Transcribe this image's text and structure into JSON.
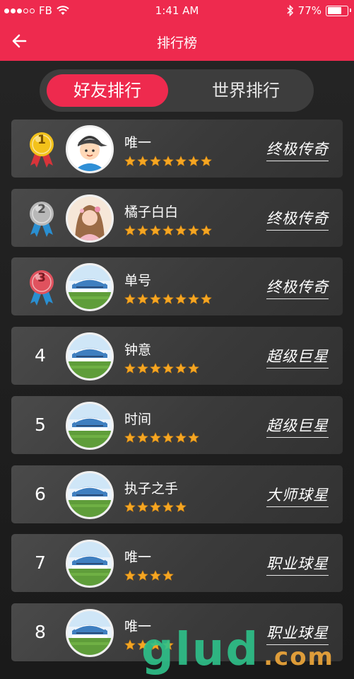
{
  "status_bar": {
    "carrier": "FB",
    "time": "1:41 AM",
    "battery": "77%",
    "battery_level": 0.77,
    "signal_dots_filled": 3,
    "signal_dots_total": 5
  },
  "header": {
    "title": "排行榜",
    "back_icon": "arrow-left-icon"
  },
  "tabs": [
    {
      "label": "好友排行",
      "active": true
    },
    {
      "label": "世界排行",
      "active": false
    }
  ],
  "players": [
    {
      "rank": "1",
      "medal": "gold",
      "name": "唯一",
      "stars": 7,
      "title": "终极传奇",
      "avatar": "boy-cartoon"
    },
    {
      "rank": "2",
      "medal": "silver",
      "name": "橘子白白",
      "stars": 7,
      "title": "终极传奇",
      "avatar": "girl-photo"
    },
    {
      "rank": "3",
      "medal": "bronze",
      "name": "单号",
      "stars": 7,
      "title": "终极传奇",
      "avatar": "stadium"
    },
    {
      "rank": "4",
      "medal": null,
      "name": "钟意",
      "stars": 6,
      "title": "超级巨星",
      "avatar": "stadium"
    },
    {
      "rank": "5",
      "medal": null,
      "name": "时间",
      "stars": 6,
      "title": "超级巨星",
      "avatar": "stadium"
    },
    {
      "rank": "6",
      "medal": null,
      "name": "执子之手",
      "stars": 5,
      "title": "大师球星",
      "avatar": "stadium"
    },
    {
      "rank": "7",
      "medal": null,
      "name": "唯一",
      "stars": 4,
      "title": "职业球星",
      "avatar": "stadium"
    },
    {
      "rank": "8",
      "medal": null,
      "name": "唯一",
      "stars": 4,
      "title": "职业球星",
      "avatar": "stadium"
    }
  ],
  "colors": {
    "accent": "#ee2a4e",
    "star": "#f5a623",
    "gold": "#f3c21b",
    "silver": "#b8b8b8",
    "bronze": "#e0525e"
  },
  "watermark": {
    "main": "glud",
    "suffix": ".com"
  }
}
